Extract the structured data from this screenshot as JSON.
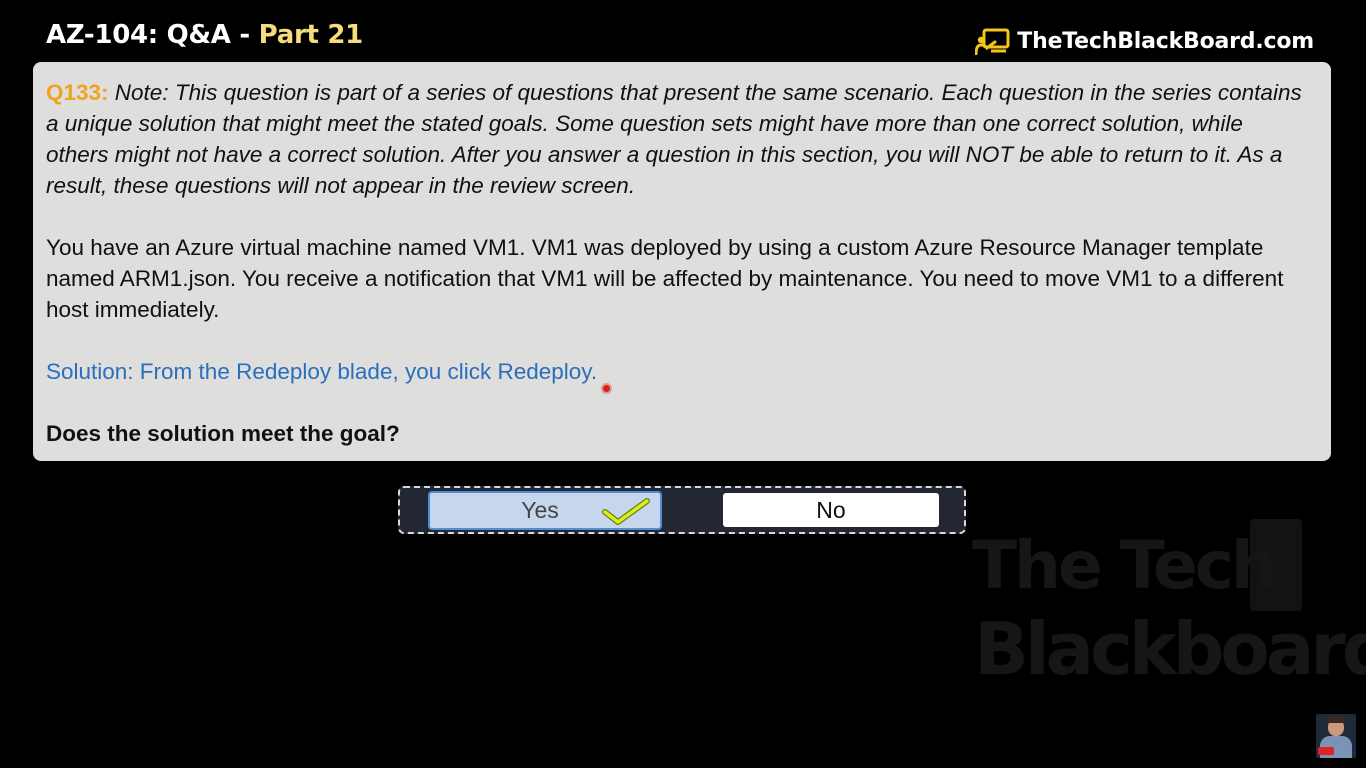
{
  "header": {
    "title_main": "AZ-104: Q&A",
    "title_sep": " - ",
    "title_part": "Part 21",
    "brand": "TheTechBlackBoard.com"
  },
  "question": {
    "number": "Q133:",
    "note": " Note: This question is part of a series of questions that present the same scenario. Each question in the series contains a unique solution that might meet the stated goals. Some question sets might have more than one correct solution, while others might not have a correct solution. After you answer a question in this section, you will NOT be able to return to it. As a result, these questions will not appear in the review screen.",
    "scenario": "You have an Azure virtual machine named VM1. VM1 was deployed by using a custom Azure Resource Manager template named ARM1.json. You receive a notification that VM1 will be affected by maintenance. You need to move VM1 to a different host immediately.",
    "solution": "Solution: From the Redeploy blade, you click Redeploy.",
    "prompt": "Does the solution meet the goal?"
  },
  "answers": {
    "yes": "Yes",
    "no": "No",
    "selected": "Yes"
  },
  "watermark": {
    "line1": "The Tech",
    "line2": "Blackboard"
  },
  "colors": {
    "question_number": "#f0a41e",
    "solution_text": "#2a6ebf",
    "title_part": "#f6dc7a",
    "card_background": "#dededc",
    "selected_answer": "#c6d6ec"
  },
  "icons": [
    "chalkboard-icon",
    "checkmark-icon"
  ]
}
